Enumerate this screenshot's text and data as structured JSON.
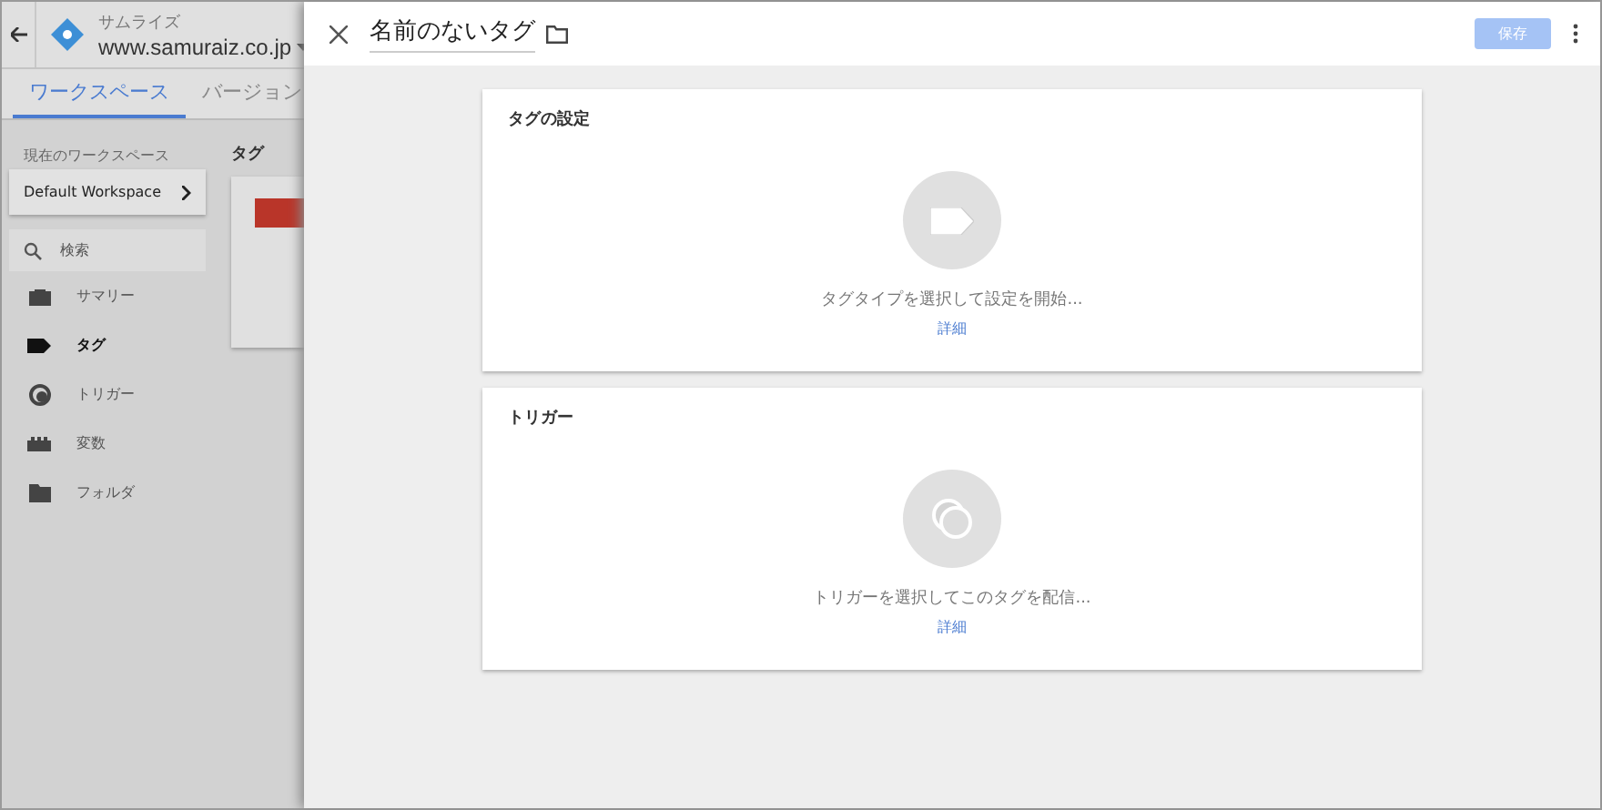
{
  "header": {
    "account": "サムライズ",
    "container": "www.samuraiz.co.jp"
  },
  "tabs": [
    {
      "label": "ワークスペース",
      "selected": true
    },
    {
      "label": "バージョン",
      "selected": false
    }
  ],
  "workspace": {
    "label": "現在のワークスペース",
    "name": "Default Workspace"
  },
  "search": {
    "placeholder": "検索"
  },
  "nav": [
    {
      "label": "サマリー",
      "kind": "summary",
      "selected": false
    },
    {
      "label": "タグ",
      "kind": "tag",
      "selected": true
    },
    {
      "label": "トリガー",
      "kind": "trigger",
      "selected": false
    },
    {
      "label": "変数",
      "kind": "variable",
      "selected": false
    },
    {
      "label": "フォルダ",
      "kind": "folder",
      "selected": false
    }
  ],
  "content": {
    "heading": "タグ"
  },
  "panel": {
    "title": "名前のないタグ",
    "save": {
      "label": "保存",
      "disabled": true
    },
    "sections": [
      {
        "kind": "tag",
        "title": "タグの設定",
        "hint": "タグタイプを選択して設定を開始...",
        "link": "詳細"
      },
      {
        "kind": "trigger",
        "title": "トリガー",
        "hint": "トリガーを選択してこのタグを配信...",
        "link": "詳細"
      }
    ]
  }
}
